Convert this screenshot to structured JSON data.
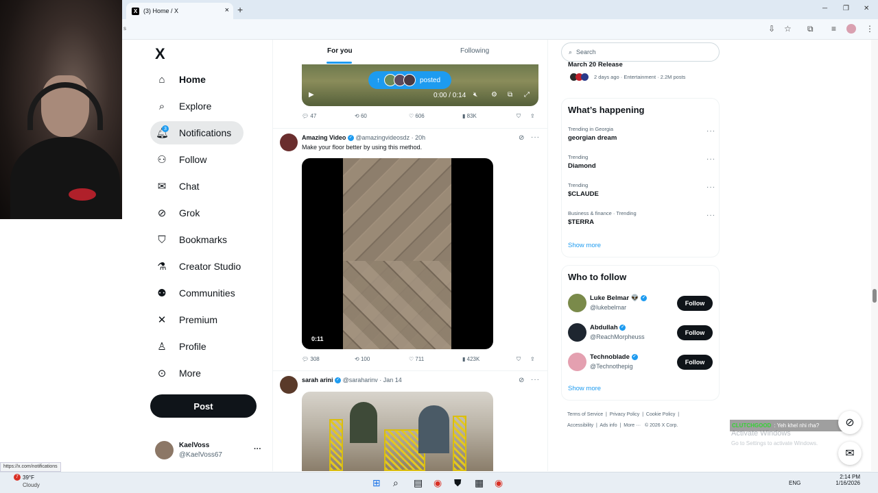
{
  "browser": {
    "tab_title": "(3) Home / X",
    "tab_close": "×",
    "new_tab": "+",
    "url_fragment": "s",
    "win_min": "─",
    "win_max": "❐",
    "win_close": "✕",
    "status_url": "https://x.com/notifications"
  },
  "nav": {
    "logo": "X",
    "items": [
      {
        "label": "Home",
        "icon": "home-icon"
      },
      {
        "label": "Explore",
        "icon": "search-icon"
      },
      {
        "label": "Notifications",
        "icon": "bell-icon",
        "badge": "3"
      },
      {
        "label": "Follow",
        "icon": "add-person-icon"
      },
      {
        "label": "Chat",
        "icon": "mail-icon"
      },
      {
        "label": "Grok",
        "icon": "grok-icon"
      },
      {
        "label": "Bookmarks",
        "icon": "bookmark-icon"
      },
      {
        "label": "Creator Studio",
        "icon": "flask-icon"
      },
      {
        "label": "Communities",
        "icon": "people-icon"
      },
      {
        "label": "Premium",
        "icon": "x-icon"
      },
      {
        "label": "Profile",
        "icon": "person-icon"
      },
      {
        "label": "More",
        "icon": "more-circle-icon"
      }
    ],
    "post_label": "Post",
    "account": {
      "name": "KaelVoss",
      "handle": "@KaelVoss67",
      "more": "···"
    }
  },
  "feed": {
    "tabs": [
      "For you",
      "Following"
    ],
    "posted_pill": "posted",
    "video1": {
      "time": "0:00 / 0:14"
    },
    "post1_actions": {
      "replies": "47",
      "reposts": "60",
      "likes": "606",
      "views": "83K"
    },
    "post2": {
      "name": "Amazing Video",
      "handle": "@amazingvideosdz",
      "age": "· 20h",
      "text": "Make your floor better by using this method.",
      "duration": "0:11",
      "actions": {
        "replies": "308",
        "reposts": "100",
        "likes": "711",
        "views": "423K"
      }
    },
    "post3": {
      "name": "sarah arini",
      "handle": "@saraharinv",
      "age": "· Jan 14"
    }
  },
  "right": {
    "search_placeholder": "Search",
    "prev_trend_title": "March 20 Release",
    "prev_trend_meta": "2 days ago · Entertainment · 2.2M posts",
    "happening_title": "What’s happening",
    "trends": [
      {
        "context": "Trending in Georgia",
        "topic": "georgian dream"
      },
      {
        "context": "Trending",
        "topic": "Diamond"
      },
      {
        "context": "Trending",
        "topic": "$CLAUDE"
      },
      {
        "context": "Business & finance · Trending",
        "topic": "$TERRA"
      }
    ],
    "show_more": "Show more",
    "who_title": "Who to follow",
    "who": [
      {
        "name": "Luke Belmar 👽",
        "handle": "@lukebelmar",
        "button": "Follow"
      },
      {
        "name": "Abdullah",
        "handle": "@ReachMorpheuss",
        "button": "Follow"
      },
      {
        "name": "Technoblade",
        "handle": "@Technothepig",
        "button": "Follow"
      }
    ],
    "footer": {
      "links": [
        "Terms of Service",
        "Privacy Policy",
        "Cookie Policy",
        "Accessibility",
        "Ads info",
        "More ···"
      ],
      "copyright": "© 2026 X Corp."
    }
  },
  "overlay": {
    "chat_user": "CLUTCHGOOD",
    "chat_msg": ": Yeh khel nhi rha?",
    "activate_title": "Activate Windows",
    "activate_sub": "Go to Settings to activate Windows."
  },
  "taskbar": {
    "weather_temp": "39°F",
    "weather_desc": "Cloudy",
    "weather_badge": "7",
    "lang": "ENG",
    "time": "2:14 PM",
    "date": "1/16/2026"
  }
}
